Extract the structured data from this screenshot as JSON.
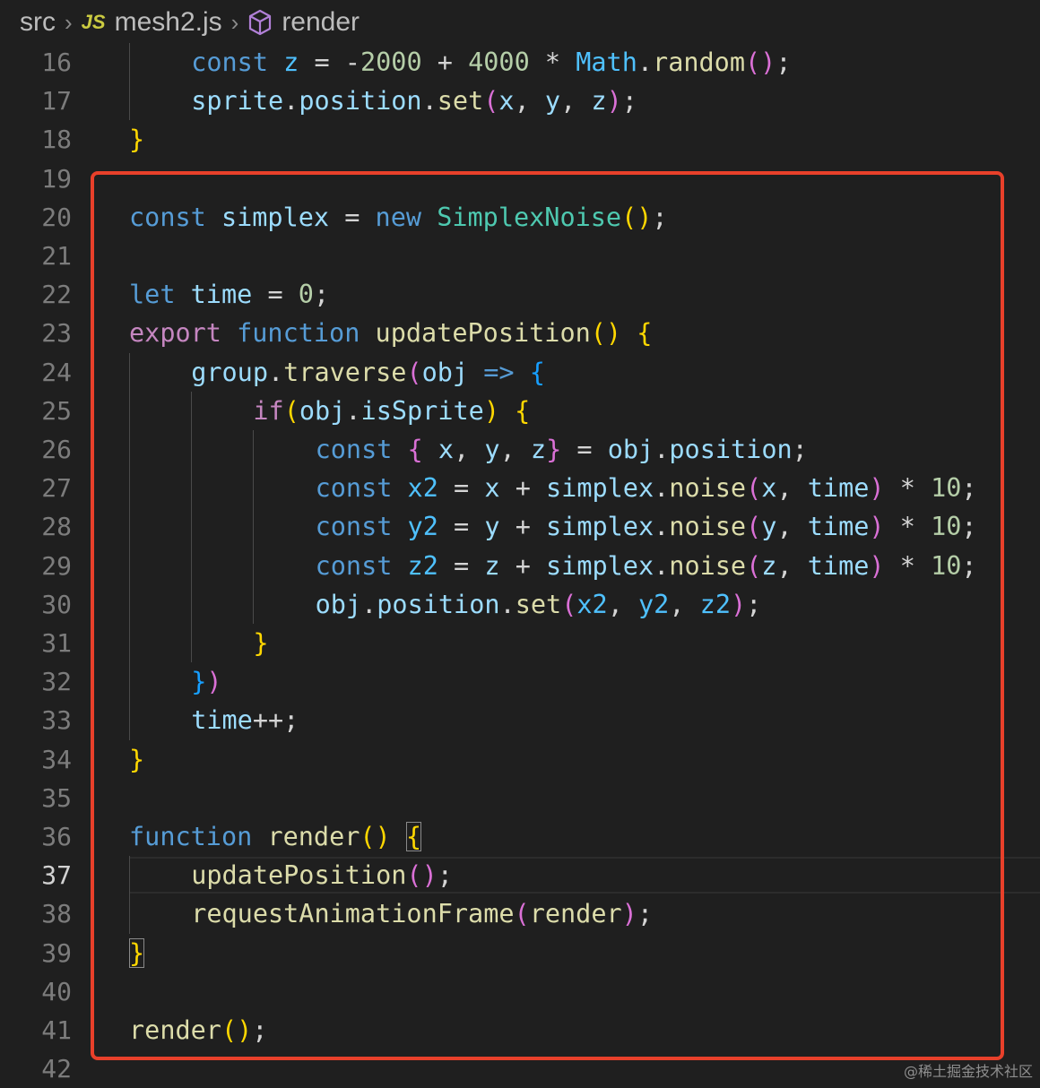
{
  "breadcrumb": {
    "folder": "src",
    "file_badge": "JS",
    "file": "mesh2.js",
    "symbol": "render"
  },
  "editor": {
    "first_line_number": 16,
    "active_line": 37,
    "lines": [
      [
        [
          "kw",
          "const "
        ],
        [
          "cst",
          "z"
        ],
        [
          "op",
          " = "
        ],
        [
          "op",
          "-"
        ],
        [
          "num",
          "2000"
        ],
        [
          "op",
          " + "
        ],
        [
          "num",
          "4000"
        ],
        [
          "op",
          " * "
        ],
        [
          "cst",
          "Math"
        ],
        [
          "op",
          "."
        ],
        [
          "fn",
          "random"
        ],
        [
          "p2",
          "()"
        ],
        [
          "op",
          ";"
        ]
      ],
      [
        [
          "var",
          "sprite"
        ],
        [
          "op",
          "."
        ],
        [
          "var",
          "position"
        ],
        [
          "op",
          "."
        ],
        [
          "fn",
          "set"
        ],
        [
          "p2",
          "("
        ],
        [
          "var",
          "x"
        ],
        [
          "op",
          ", "
        ],
        [
          "var",
          "y"
        ],
        [
          "op",
          ", "
        ],
        [
          "var",
          "z"
        ],
        [
          "p2",
          ")"
        ],
        [
          "op",
          ";"
        ]
      ],
      [
        [
          "p1",
          "}"
        ]
      ],
      [],
      [
        [
          "kw",
          "const "
        ],
        [
          "var",
          "simplex"
        ],
        [
          "op",
          " = "
        ],
        [
          "kw",
          "new "
        ],
        [
          "cls",
          "SimplexNoise"
        ],
        [
          "p1",
          "()"
        ],
        [
          "op",
          ";"
        ]
      ],
      [],
      [
        [
          "kw",
          "let "
        ],
        [
          "var",
          "time"
        ],
        [
          "op",
          " = "
        ],
        [
          "num",
          "0"
        ],
        [
          "op",
          ";"
        ]
      ],
      [
        [
          "ctl",
          "export "
        ],
        [
          "kw",
          "function "
        ],
        [
          "fn",
          "updatePosition"
        ],
        [
          "p1",
          "()"
        ],
        [
          "op",
          " "
        ],
        [
          "p1",
          "{"
        ]
      ],
      [
        [
          "var",
          "group"
        ],
        [
          "op",
          "."
        ],
        [
          "fn",
          "traverse"
        ],
        [
          "p2",
          "("
        ],
        [
          "var",
          "obj"
        ],
        [
          "op",
          " "
        ],
        [
          "kw",
          "=>"
        ],
        [
          "op",
          " "
        ],
        [
          "p3",
          "{"
        ]
      ],
      [
        [
          "ctl",
          "if"
        ],
        [
          "p1",
          "("
        ],
        [
          "var",
          "obj"
        ],
        [
          "op",
          "."
        ],
        [
          "var",
          "isSprite"
        ],
        [
          "p1",
          ")"
        ],
        [
          "op",
          " "
        ],
        [
          "p1",
          "{"
        ]
      ],
      [
        [
          "kw",
          "const "
        ],
        [
          "p2",
          "{"
        ],
        [
          "op",
          " "
        ],
        [
          "var",
          "x"
        ],
        [
          "op",
          ", "
        ],
        [
          "var",
          "y"
        ],
        [
          "op",
          ", "
        ],
        [
          "var",
          "z"
        ],
        [
          "p2",
          "}"
        ],
        [
          "op",
          " = "
        ],
        [
          "var",
          "obj"
        ],
        [
          "op",
          "."
        ],
        [
          "var",
          "position"
        ],
        [
          "op",
          ";"
        ]
      ],
      [
        [
          "kw",
          "const "
        ],
        [
          "cst",
          "x2"
        ],
        [
          "op",
          " = "
        ],
        [
          "var",
          "x"
        ],
        [
          "op",
          " + "
        ],
        [
          "var",
          "simplex"
        ],
        [
          "op",
          "."
        ],
        [
          "fn",
          "noise"
        ],
        [
          "p2",
          "("
        ],
        [
          "var",
          "x"
        ],
        [
          "op",
          ", "
        ],
        [
          "var",
          "time"
        ],
        [
          "p2",
          ")"
        ],
        [
          "op",
          " * "
        ],
        [
          "num",
          "10"
        ],
        [
          "op",
          ";"
        ]
      ],
      [
        [
          "kw",
          "const "
        ],
        [
          "cst",
          "y2"
        ],
        [
          "op",
          " = "
        ],
        [
          "var",
          "y"
        ],
        [
          "op",
          " + "
        ],
        [
          "var",
          "simplex"
        ],
        [
          "op",
          "."
        ],
        [
          "fn",
          "noise"
        ],
        [
          "p2",
          "("
        ],
        [
          "var",
          "y"
        ],
        [
          "op",
          ", "
        ],
        [
          "var",
          "time"
        ],
        [
          "p2",
          ")"
        ],
        [
          "op",
          " * "
        ],
        [
          "num",
          "10"
        ],
        [
          "op",
          ";"
        ]
      ],
      [
        [
          "kw",
          "const "
        ],
        [
          "cst",
          "z2"
        ],
        [
          "op",
          " = "
        ],
        [
          "var",
          "z"
        ],
        [
          "op",
          " + "
        ],
        [
          "var",
          "simplex"
        ],
        [
          "op",
          "."
        ],
        [
          "fn",
          "noise"
        ],
        [
          "p2",
          "("
        ],
        [
          "var",
          "z"
        ],
        [
          "op",
          ", "
        ],
        [
          "var",
          "time"
        ],
        [
          "p2",
          ")"
        ],
        [
          "op",
          " * "
        ],
        [
          "num",
          "10"
        ],
        [
          "op",
          ";"
        ]
      ],
      [
        [
          "var",
          "obj"
        ],
        [
          "op",
          "."
        ],
        [
          "var",
          "position"
        ],
        [
          "op",
          "."
        ],
        [
          "fn",
          "set"
        ],
        [
          "p2",
          "("
        ],
        [
          "cst",
          "x2"
        ],
        [
          "op",
          ", "
        ],
        [
          "cst",
          "y2"
        ],
        [
          "op",
          ", "
        ],
        [
          "cst",
          "z2"
        ],
        [
          "p2",
          ")"
        ],
        [
          "op",
          ";"
        ]
      ],
      [
        [
          "p1",
          "}"
        ]
      ],
      [
        [
          "p3",
          "}"
        ],
        [
          "p2",
          ")"
        ]
      ],
      [
        [
          "var",
          "time"
        ],
        [
          "op",
          "++;"
        ]
      ],
      [
        [
          "p1",
          "}"
        ]
      ],
      [],
      [
        [
          "kw",
          "function "
        ],
        [
          "fn",
          "render"
        ],
        [
          "p1",
          "()"
        ],
        [
          "op",
          " "
        ],
        [
          "p1box",
          "{"
        ]
      ],
      [
        [
          "fn",
          "updatePosition"
        ],
        [
          "p2",
          "()"
        ],
        [
          "op",
          ";"
        ]
      ],
      [
        [
          "fn",
          "requestAnimationFrame"
        ],
        [
          "p2",
          "("
        ],
        [
          "fn",
          "render"
        ],
        [
          "p2",
          ")"
        ],
        [
          "op",
          ";"
        ]
      ],
      [
        [
          "p1box",
          "}"
        ]
      ],
      [],
      [
        [
          "fn",
          "render"
        ],
        [
          "p1",
          "()"
        ],
        [
          "op",
          ";"
        ]
      ],
      []
    ]
  },
  "watermark": "@稀土掘金技术社区"
}
